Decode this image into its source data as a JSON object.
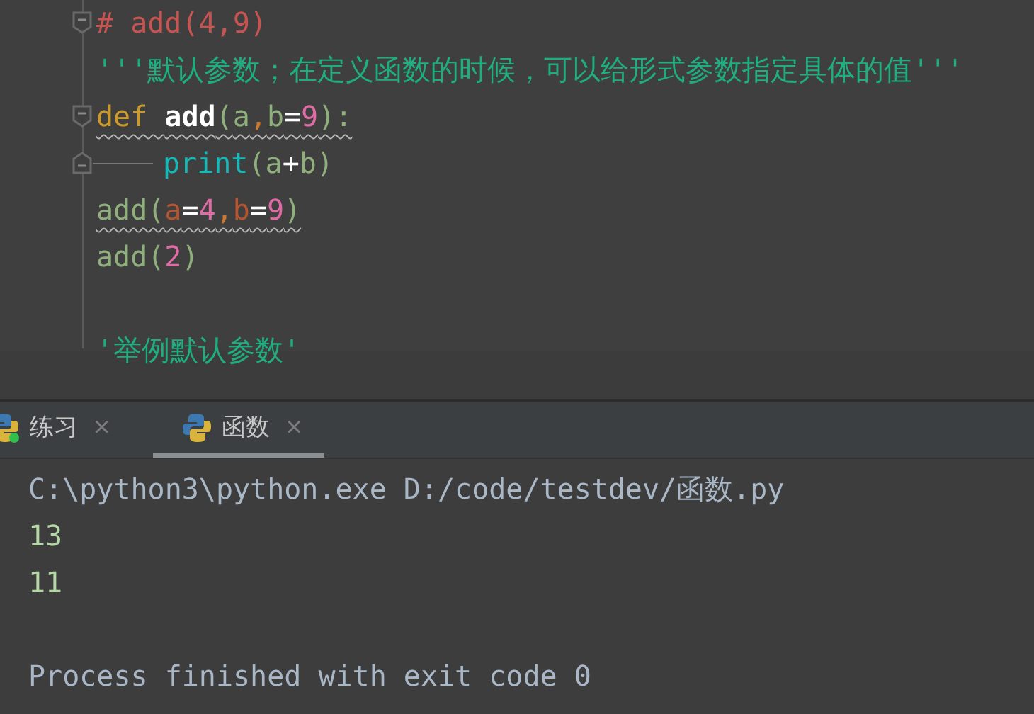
{
  "editor": {
    "lines": [
      {
        "tokens": [
          {
            "text": "# add(4,9)",
            "kind": "comment"
          }
        ],
        "fold_start": true,
        "warning": false
      },
      {
        "tokens": [
          {
            "text": "'''默认参数；在定义函数的时候，可以给形式参数指定具体的值'''",
            "kind": "string"
          }
        ],
        "warning": false
      },
      {
        "tokens": [
          {
            "text": "def ",
            "kind": "keyword"
          },
          {
            "text": "add",
            "kind": "funcname"
          },
          {
            "text": "(",
            "kind": "plain"
          },
          {
            "text": "a",
            "kind": "param"
          },
          {
            "text": ",",
            "kind": "punct"
          },
          {
            "text": "b",
            "kind": "param"
          },
          {
            "text": "=",
            "kind": "op"
          },
          {
            "text": "9",
            "kind": "number"
          },
          {
            "text": "):",
            "kind": "plain"
          }
        ],
        "fold_start": true,
        "warning": true
      },
      {
        "tokens": [
          {
            "text": "print",
            "kind": "builtin"
          },
          {
            "text": "(",
            "kind": "plain"
          },
          {
            "text": "a",
            "kind": "plain"
          },
          {
            "text": "+",
            "kind": "op"
          },
          {
            "text": "b",
            "kind": "plain"
          },
          {
            "text": ")",
            "kind": "plain"
          }
        ],
        "fold_end": true,
        "indent": true,
        "warning": false
      },
      {
        "tokens": [
          {
            "text": "add(",
            "kind": "plain"
          },
          {
            "text": "a",
            "kind": "kwarg"
          },
          {
            "text": "=",
            "kind": "op"
          },
          {
            "text": "4",
            "kind": "number"
          },
          {
            "text": ",",
            "kind": "punct"
          },
          {
            "text": "b",
            "kind": "kwarg"
          },
          {
            "text": "=",
            "kind": "op"
          },
          {
            "text": "9",
            "kind": "number"
          },
          {
            "text": ")",
            "kind": "plain"
          }
        ],
        "warning": true
      },
      {
        "tokens": [
          {
            "text": "add(",
            "kind": "plain"
          },
          {
            "text": "2",
            "kind": "number"
          },
          {
            "text": ")",
            "kind": "plain"
          }
        ],
        "warning": false
      },
      {
        "warning": false
      },
      {
        "tokens": [
          {
            "text": "'举例默认参数'",
            "kind": "string"
          }
        ],
        "warning": false
      }
    ]
  },
  "run_tabs": [
    {
      "label": "练习",
      "close": "×",
      "selected": false,
      "running": true
    },
    {
      "label": "函数",
      "close": "×",
      "selected": true,
      "running": false
    }
  ],
  "console": [
    {
      "text": "C:\\python3\\python.exe D:/code/testdev/函数.py",
      "kind": "command"
    },
    {
      "text": "13",
      "kind": "output"
    },
    {
      "text": "11",
      "kind": "output"
    },
    {
      "kind": "blank"
    },
    {
      "text": "Process finished with exit code 0",
      "kind": "command"
    }
  ]
}
